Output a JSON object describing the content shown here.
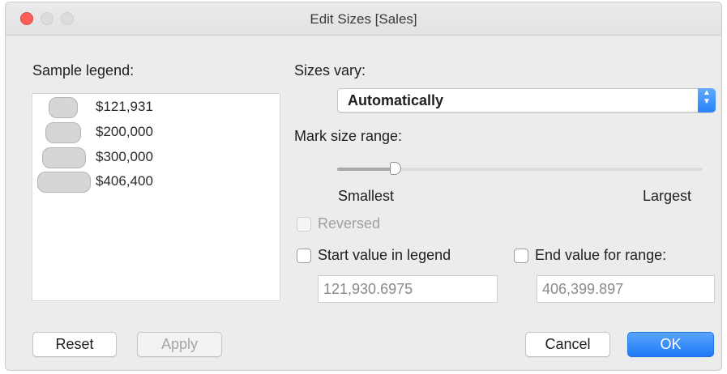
{
  "window": {
    "title": "Edit Sizes [Sales]"
  },
  "legend": {
    "label": "Sample legend:",
    "items": [
      {
        "value": "$121,931"
      },
      {
        "value": "$200,000"
      },
      {
        "value": "$300,000"
      },
      {
        "value": "$406,400"
      }
    ]
  },
  "sizes_vary": {
    "label": "Sizes vary:",
    "selected": "Automatically"
  },
  "mark_size_range": {
    "label": "Mark size range:",
    "smallest_label": "Smallest",
    "largest_label": "Largest",
    "slider_level": 0.16
  },
  "reversed": {
    "label": "Reversed",
    "checked": false,
    "enabled": false
  },
  "start_value": {
    "label": "Start value in legend",
    "checked": false,
    "value": "121,930.6975"
  },
  "end_value": {
    "label": "End value for range:",
    "checked": false,
    "value": "406,399.897"
  },
  "buttons": {
    "reset": "Reset",
    "apply": "Apply",
    "cancel": "Cancel",
    "ok": "OK"
  },
  "colors": {
    "accent": "#2b83f6",
    "close_light": "#fc5f57"
  }
}
